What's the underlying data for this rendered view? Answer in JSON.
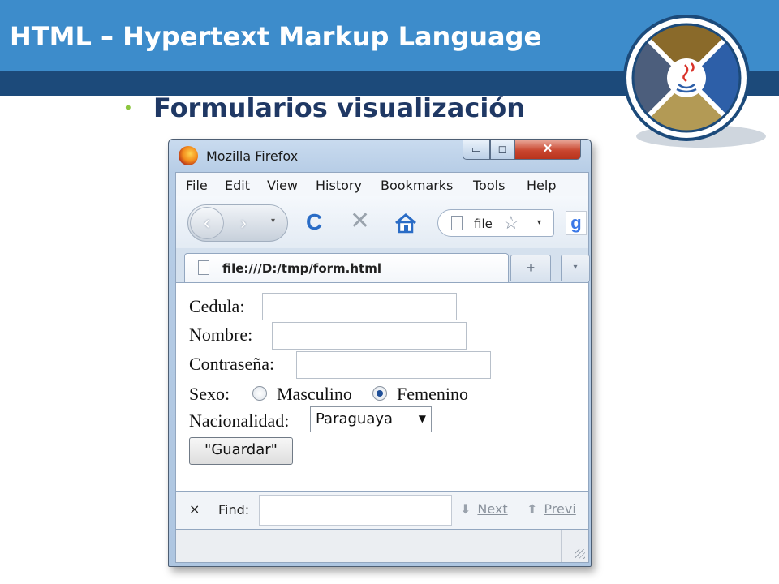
{
  "slide": {
    "title": "HTML – Hypertext Markup Language",
    "bullet": "•",
    "subtitle": "Formularios visualización"
  },
  "window": {
    "title": "Mozilla Firefox",
    "controls": {
      "minimize": "▭",
      "maximize": "◻",
      "close": "✕"
    }
  },
  "menu": {
    "items": [
      "File",
      "Edit",
      "View",
      "History",
      "Bookmarks",
      "Tools",
      "Help"
    ]
  },
  "nav": {
    "back": "‹",
    "forward": "›",
    "dropdown": "▾",
    "reload": "C",
    "stop": "✕",
    "url": "file",
    "star": "☆",
    "url_dropdown": "▾",
    "search_engine": "g"
  },
  "tab": {
    "label": "file:///D:/tmp/form.html",
    "new_tab": "+",
    "list": "▾"
  },
  "form": {
    "cedula_label": "Cedula:",
    "nombre_label": "Nombre:",
    "contrasena_label": "Contraseña:",
    "sexo_label": "Sexo:",
    "masculino_label": "Masculino",
    "femenino_label": "Femenino",
    "sexo_selected": "Femenino",
    "nacionalidad_label": "Nacionalidad:",
    "nacionalidad_value": "Paraguaya",
    "guardar_label": "\"Guardar\""
  },
  "findbar": {
    "close": "×",
    "label": "Find:",
    "next_label": "Next",
    "prev_label": "Previ",
    "next_arrow": "⬇",
    "prev_arrow": "⬆"
  },
  "colors": {
    "title_bar": "#3d8ccb",
    "title_strip": "#1c4a7a",
    "subtitle": "#1f3864",
    "bullet": "#8dc63f"
  }
}
